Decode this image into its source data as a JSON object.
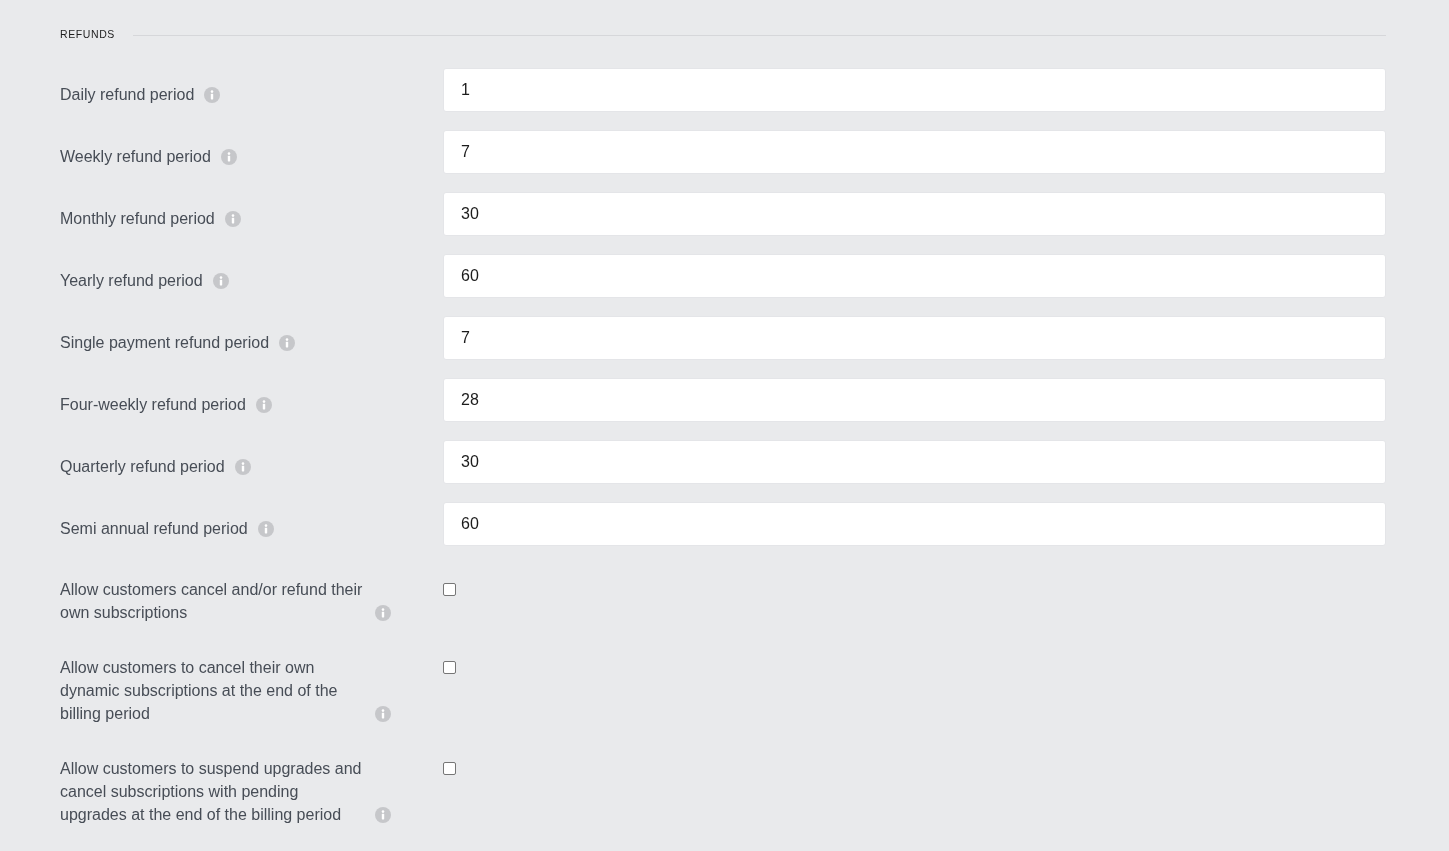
{
  "section_title": "REFUNDS",
  "settings": [
    {
      "kind": "input",
      "label": "Daily refund period",
      "value": "1"
    },
    {
      "kind": "input",
      "label": "Weekly refund period",
      "value": "7"
    },
    {
      "kind": "input",
      "label": "Monthly refund period",
      "value": "30"
    },
    {
      "kind": "input",
      "label": "Yearly refund period",
      "value": "60"
    },
    {
      "kind": "input",
      "label": "Single payment refund period",
      "value": "7"
    },
    {
      "kind": "input",
      "label": "Four-weekly refund period",
      "value": "28"
    },
    {
      "kind": "input",
      "label": "Quarterly refund period",
      "value": "30"
    },
    {
      "kind": "input",
      "label": "Semi annual refund period",
      "value": "60"
    },
    {
      "kind": "checkbox",
      "label": "Allow customers cancel and/or refund their own subscriptions",
      "checked": false
    },
    {
      "kind": "checkbox",
      "label": "Allow customers to cancel their own dynamic subscriptions at the end of the billing period",
      "checked": false
    },
    {
      "kind": "checkbox",
      "label": "Allow customers to suspend upgrades and cancel subscriptions with pending upgrades at the end of the billing period",
      "checked": false
    }
  ]
}
